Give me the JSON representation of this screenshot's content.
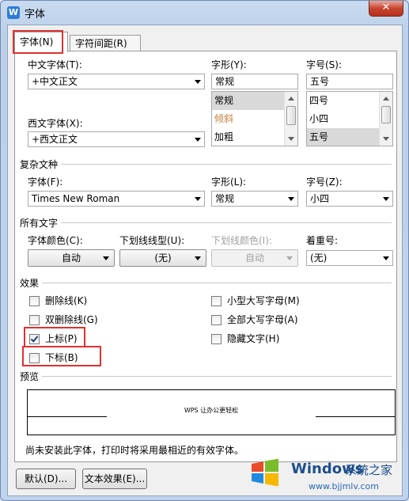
{
  "window": {
    "title": "字体",
    "app_icon_letter": "W",
    "close_glyph": "✕"
  },
  "tabs": [
    {
      "label": "字体(N)",
      "active": true
    },
    {
      "label": "字符间距(R)",
      "active": false
    }
  ],
  "chinese_font": {
    "label": "中文字体(T):",
    "value": "+中文正文"
  },
  "western_font": {
    "label": "西文字体(X):",
    "value": "+西文正文"
  },
  "style": {
    "label": "字形(Y):",
    "value": "常规",
    "options": [
      "常规",
      "倾斜",
      "加粗"
    ],
    "selected": 0
  },
  "size": {
    "label": "字号(S):",
    "value": "五号",
    "options": [
      "四号",
      "小四",
      "五号"
    ],
    "selected": 2
  },
  "complex": {
    "section": "复杂文种",
    "font_label": "字体(F):",
    "font_value": "Times New Roman",
    "style_label": "字形(L):",
    "style_value": "常规",
    "size_label": "字号(Z):",
    "size_value": "小四"
  },
  "all_text": {
    "section": "所有文字",
    "color_label": "字体颜色(C):",
    "color_value": "自动",
    "underline_label": "下划线线型(U):",
    "underline_value": "(无)",
    "underline_color_label": "下划线颜色(I):",
    "underline_color_value": "自动",
    "emphasis_label": "着重号:",
    "emphasis_value": "(无)"
  },
  "effects": {
    "section": "效果",
    "left": [
      {
        "label": "删除线(K)",
        "checked": false
      },
      {
        "label": "双删除线(G)",
        "checked": false
      },
      {
        "label": "上标(P)",
        "checked": true
      },
      {
        "label": "下标(B)",
        "checked": false
      }
    ],
    "right": [
      {
        "label": "小型大写字母(M)",
        "checked": false
      },
      {
        "label": "全部大写字母(A)",
        "checked": false
      },
      {
        "label": "隐藏文字(H)",
        "checked": false
      }
    ]
  },
  "preview": {
    "section": "预览",
    "text": "WPS 让办公更轻松"
  },
  "note": "尚未安装此字体，打印时将采用最相近的有效字体。",
  "buttons": {
    "default": "默认(D)...",
    "text_effects": "文本效果(E)..."
  },
  "watermark": {
    "title": "Windows",
    "subtitle": "系统之家",
    "url": "www.bjjmlv.com"
  },
  "colors": {
    "highlight": "#e03030",
    "title_bar": "#c9dbf0",
    "tick": "#1e3c78"
  }
}
